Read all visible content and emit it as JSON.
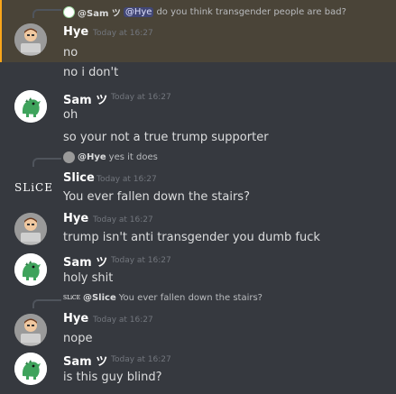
{
  "messages": [
    {
      "reply_to": {
        "user": "@Sam ツ",
        "mention": "@Hye",
        "text": "do you think transgender people are bad?"
      },
      "user": "Hye",
      "timestamp": "Today at 16:27",
      "lines": [
        "no",
        "no i don't"
      ]
    },
    {
      "user": "Sam ツ",
      "timestamp": "Today at 16:27",
      "lines": [
        "oh",
        "so your not a true trump supporter"
      ]
    },
    {
      "reply_to": {
        "user": "@Hye",
        "text": "yes it does"
      },
      "user": "Slice",
      "timestamp": "Today at 16:27",
      "avatar_text": "SLiCE",
      "lines": [
        "You ever fallen down the stairs?"
      ]
    },
    {
      "user": "Hye",
      "timestamp": "Today at 16:27",
      "lines": [
        "trump isn't anti transgender you dumb fuck"
      ]
    },
    {
      "user": "Sam ツ",
      "timestamp": "Today at 16:27",
      "lines": [
        "holy shit"
      ]
    },
    {
      "reply_to": {
        "avatar_text": "SLiCE",
        "user": "@Slice",
        "text": "You ever fallen down the stairs?"
      },
      "user": "Hye",
      "timestamp": "Today at 16:27",
      "lines": [
        "nope"
      ]
    },
    {
      "user": "Sam ツ",
      "timestamp": "Today at 16:27",
      "lines": [
        "is this guy blind?"
      ]
    }
  ],
  "colors": {
    "background": "#36393f",
    "mention_highlight": "#4a4438",
    "mention_border": "#faa61a",
    "username": "#ffffff",
    "timestamp": "#72767d"
  },
  "icons": {
    "hye_avatar": "person-with-laptop",
    "sam_avatar": "green-dinosaur",
    "slice_avatar": "slice-text-logo"
  }
}
